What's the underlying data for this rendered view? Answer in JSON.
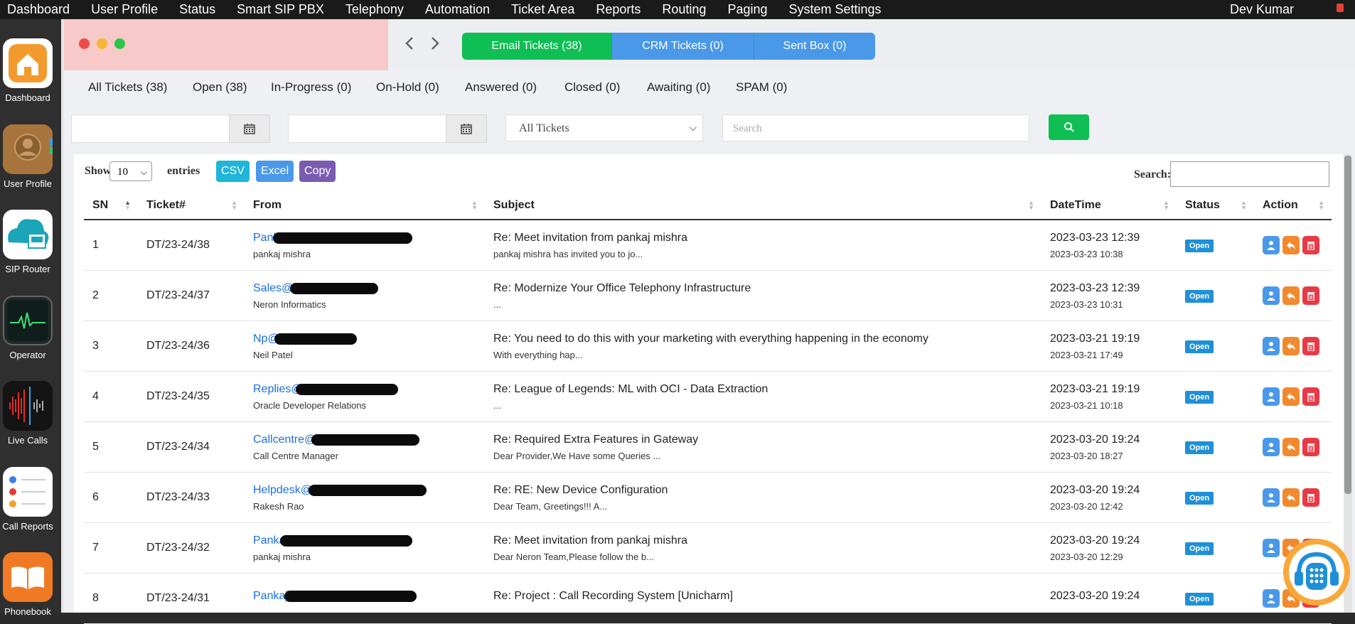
{
  "menu": {
    "items": [
      "Dashboard",
      "User Profile",
      "Status",
      "Smart SIP PBX",
      "Telephony",
      "Automation",
      "Ticket Area",
      "Reports",
      "Routing",
      "Paging",
      "System Settings"
    ],
    "user": "Dev Kumar"
  },
  "dock": {
    "items": [
      {
        "label": "Dashboard",
        "icon": "home-icon"
      },
      {
        "label": "User Profile",
        "icon": "contacts-icon"
      },
      {
        "label": "SIP Router",
        "icon": "sip-router-icon",
        "badge": "SIP"
      },
      {
        "label": "Operator",
        "icon": "activity-monitor-icon"
      },
      {
        "label": "Live Calls",
        "icon": "waveform-icon"
      },
      {
        "label": "Call Reports",
        "icon": "reminders-icon"
      },
      {
        "label": "Phonebook",
        "icon": "book-icon"
      }
    ]
  },
  "tabs": [
    {
      "label": "Email Tickets (38)",
      "color": "#0fbf54"
    },
    {
      "label": "CRM Tickets (0)",
      "color": "#4a98e8"
    },
    {
      "label": "Sent Box (0)",
      "color": "#4a98e8"
    }
  ],
  "filters": [
    "All Tickets (38)",
    "Open (38)",
    "In-Progress (0)",
    "On-Hold (0)",
    "Answered (0)",
    "Closed (0)",
    "Awaiting (0)",
    "SPAM (0)"
  ],
  "search": {
    "type_select": "All Tickets",
    "placeholder": "Search"
  },
  "table_controls": {
    "show_label": "Show",
    "entries_value": "10",
    "entries_label": "entries",
    "csv": "CSV",
    "excel": "Excel",
    "copy": "Copy",
    "search_label": "Search:"
  },
  "columns": [
    "SN",
    "Ticket#",
    "From",
    "Subject",
    "DateTime",
    "Status",
    "Action"
  ],
  "rows": [
    {
      "sn": "1",
      "ticket": "DT/23-24/38",
      "email": "Pank",
      "from": "pankaj mishra",
      "subject": "Re: Meet invitation from pankaj mishra",
      "preview": "pankaj mishra has invited you to jo...",
      "dt1": "2023-03-23 12:39",
      "dt2": "2023-03-23 10:38",
      "status": "Open"
    },
    {
      "sn": "2",
      "ticket": "DT/23-24/37",
      "email": "Sales@",
      "from": "Neron Informatics",
      "subject": "Re: Modernize Your Office Telephony Infrastructure",
      "preview": "...",
      "dt1": "2023-03-23 12:39",
      "dt2": "2023-03-23 10:31",
      "status": "Open"
    },
    {
      "sn": "3",
      "ticket": "DT/23-24/36",
      "email": "Np@",
      "from": "Neil Patel",
      "subject": "Re: You need to do this with your marketing with everything happening in the economy",
      "preview": "With everything hap...",
      "dt1": "2023-03-21 19:19",
      "dt2": "2023-03-21 17:49",
      "status": "Open"
    },
    {
      "sn": "4",
      "ticket": "DT/23-24/35",
      "email": "Replies@",
      "from": "Oracle Developer Relations",
      "subject": "Re: League of Legends: ML with OCI - Data Extraction",
      "preview": "...",
      "dt1": "2023-03-21 19:19",
      "dt2": "2023-03-21 10:18",
      "status": "Open"
    },
    {
      "sn": "5",
      "ticket": "DT/23-24/34",
      "email": "Callcentre@",
      "from": "Call Centre Manager",
      "subject": "Re: Required Extra Features in Gateway",
      "preview": "Dear Provider,We Have some Queries ...",
      "dt1": "2023-03-20 19:24",
      "dt2": "2023-03-20 18:27",
      "status": "Open"
    },
    {
      "sn": "6",
      "ticket": "DT/23-24/33",
      "email": "Helpdesk@",
      "from": "Rakesh Rao",
      "subject": "Re: RE: New Device Configuration",
      "preview": "Dear Team, Greetings!!! A...",
      "dt1": "2023-03-20 19:24",
      "dt2": "2023-03-20 12:42",
      "status": "Open"
    },
    {
      "sn": "7",
      "ticket": "DT/23-24/32",
      "email": "Panka",
      "from": "pankaj mishra",
      "subject": "Re: Meet invitation from pankaj mishra",
      "preview": "Dear Neron Team,Please follow the b...",
      "dt1": "2023-03-20 19:24",
      "dt2": "2023-03-20 12:29",
      "status": "Open"
    },
    {
      "sn": "8",
      "ticket": "DT/23-24/31",
      "email": "Pankaj",
      "from": "",
      "subject": "Re: Project : Call Recording System [Unicharm]",
      "preview": "",
      "dt1": "2023-03-20 19:24",
      "dt2": "",
      "status": "Open"
    }
  ],
  "colors": {
    "accent_green": "#0fbf54",
    "accent_blue": "#4a98e8",
    "badge": "#1f8fd8",
    "link": "#1a6ee0"
  }
}
